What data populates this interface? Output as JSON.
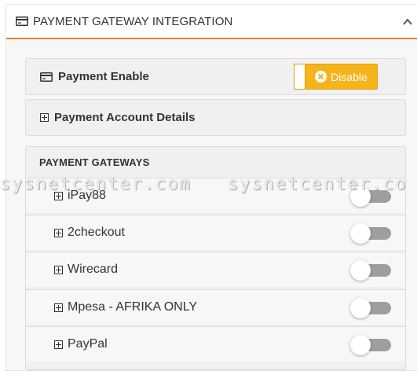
{
  "header": {
    "title": "PAYMENT GATEWAY INTEGRATION",
    "icon": "credit-card-icon",
    "collapse_icon": "chevron-up-icon"
  },
  "enable_row": {
    "label": "Payment Enable",
    "icon": "credit-card-icon",
    "button_label": "Disable",
    "button_color": "#f6b41c"
  },
  "account_row": {
    "label": "Payment Account Details",
    "icon": "plus-square-icon"
  },
  "gateways": {
    "title": "PAYMENT GATEWAYS",
    "items": [
      {
        "label": "iPay88",
        "enabled": false
      },
      {
        "label": "2checkout",
        "enabled": false
      },
      {
        "label": "Wirecard",
        "enabled": false
      },
      {
        "label": "Mpesa - AFRIKA ONLY",
        "enabled": false
      },
      {
        "label": "PayPal",
        "enabled": false
      }
    ]
  },
  "watermark": {
    "left_text": "sysnetcenter.com",
    "right_text": "sysnetcenter.co"
  },
  "colors": {
    "accent_border": "#e77d35",
    "toggle_off": "#9e9e9e"
  }
}
